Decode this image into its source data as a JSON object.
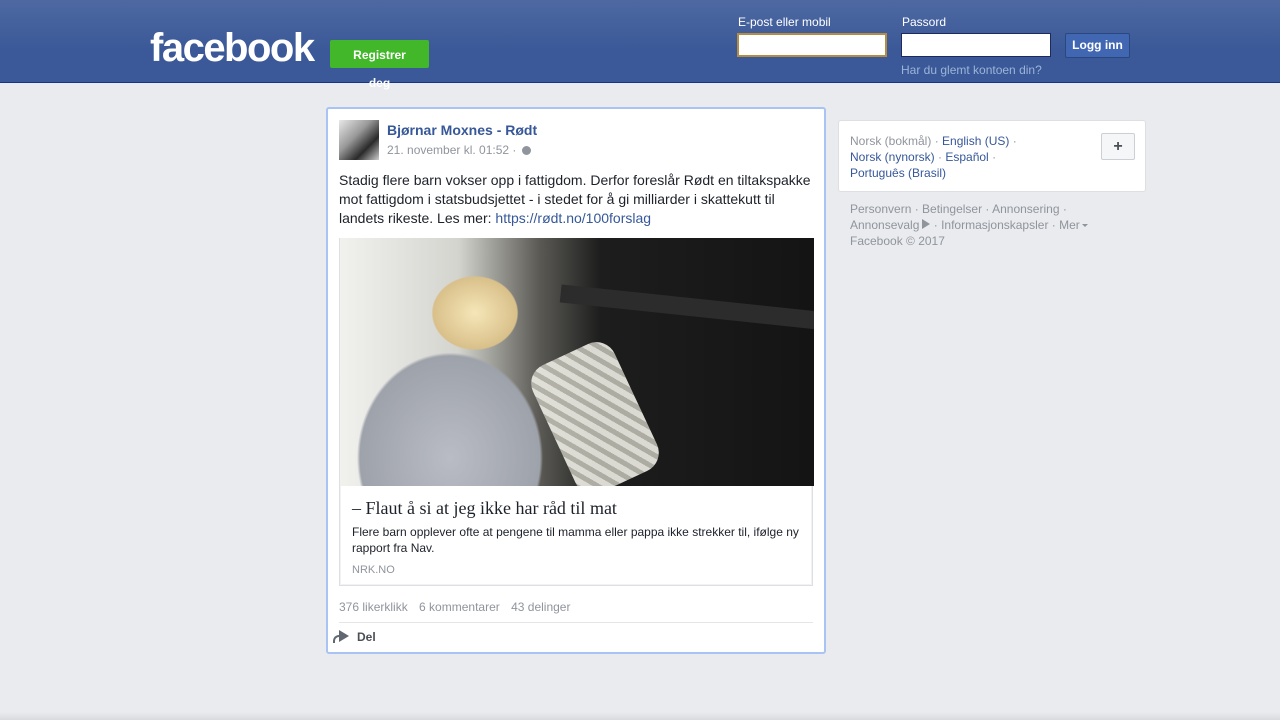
{
  "header": {
    "logo": "facebook",
    "register_label": "Registrer deg",
    "email_label": "E-post eller mobil",
    "email_value": "",
    "password_label": "Passord",
    "password_value": "",
    "login_label": "Logg inn",
    "forgot_label": "Har du glemt kontoen din?"
  },
  "post": {
    "author": "Bjørnar Moxnes - Rødt",
    "timestamp": "21. november kl. 01:52 ·",
    "text": "Stadig flere barn vokser opp i fattigdom. Derfor foreslår Rødt en tiltakspakke mot fattigdom i statsbudsjettet - i stedet for å gi milliarder i skattekutt til landets rikeste. Les mer: ",
    "link_text": "https://rødt.no/100forslag",
    "link_card": {
      "title": "– Flaut å si at jeg ikke har råd til mat",
      "description": "Flere barn opplever ofte at pengene til mamma eller pappa ikke strekker til, ifølge ny rapport fra Nav.",
      "source": "NRK.NO"
    },
    "stats": {
      "likes": "376 likerklikk",
      "comments": "6 kommentarer",
      "shares": "43 delinger"
    },
    "share_label": "Del"
  },
  "languages": {
    "current": "Norsk (bokmål)",
    "items": [
      "English (US)",
      "Norsk (nynorsk)",
      "Español",
      "Português (Brasil)"
    ],
    "add_label": "+"
  },
  "footer": {
    "links": [
      "Personvern",
      "Betingelser",
      "Annonsering",
      "Annonsevalg",
      "Informasjonskapsler",
      "Mer"
    ],
    "copyright": "Facebook © 2017"
  },
  "colors": {
    "header_blue": "#3b5998",
    "link_blue": "#365899",
    "register_green": "#42b72a"
  }
}
